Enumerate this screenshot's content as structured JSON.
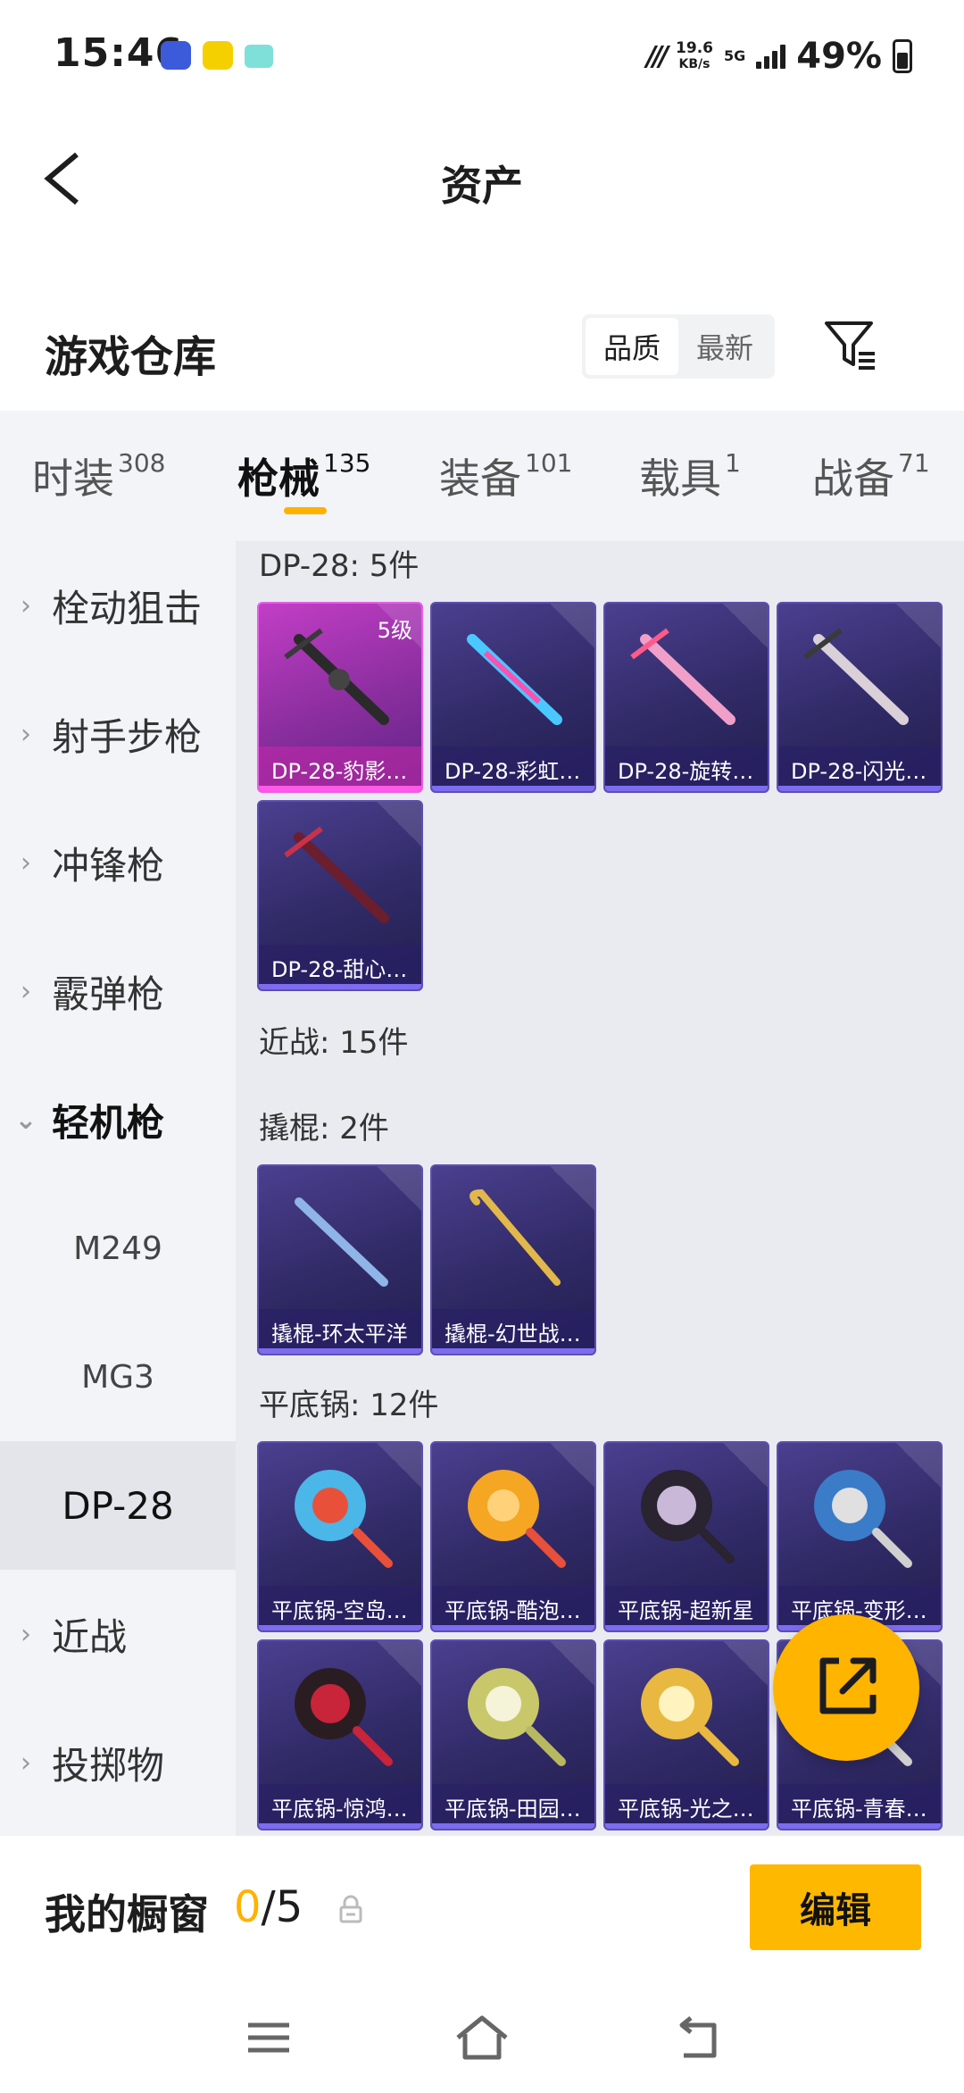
{
  "status_bar": {
    "time": "15:46",
    "network_speed": "19.6",
    "network_unit": "KB/s",
    "network_type": "5G",
    "battery": "49%"
  },
  "title_bar": {
    "title": "资产"
  },
  "warehouse": {
    "title": "游戏仓库",
    "sort_options": [
      "品质",
      "最新"
    ],
    "sort_active": "品质"
  },
  "category_tabs": [
    {
      "label": "时装",
      "count": "308"
    },
    {
      "label": "枪械",
      "count": "135",
      "active": true
    },
    {
      "label": "装备",
      "count": "101"
    },
    {
      "label": "载具",
      "count": "1"
    },
    {
      "label": "战备",
      "count": "71"
    }
  ],
  "sidebar": [
    {
      "label": "栓动狙击",
      "type": "collapsed"
    },
    {
      "label": "射手步枪",
      "type": "collapsed"
    },
    {
      "label": "冲锋枪",
      "type": "collapsed"
    },
    {
      "label": "霰弹枪",
      "type": "collapsed"
    },
    {
      "label": "轻机枪",
      "type": "expanded"
    },
    {
      "label": "M249",
      "type": "sub"
    },
    {
      "label": "MG3",
      "type": "sub"
    },
    {
      "label": "DP-28",
      "type": "selected"
    },
    {
      "label": "近战",
      "type": "collapsed"
    },
    {
      "label": "投掷物",
      "type": "collapsed"
    }
  ],
  "sections": {
    "dp28": {
      "label": "DP-28: 5件"
    },
    "melee": {
      "label": "近战: 15件"
    },
    "crowbar": {
      "label": "撬棍: 2件"
    },
    "pan": {
      "label": "平底锅: 12件"
    }
  },
  "items": {
    "dp28": [
      {
        "name": "DP-28-豹影…",
        "level": "5级",
        "rarity": "legend"
      },
      {
        "name": "DP-28-彩虹…"
      },
      {
        "name": "DP-28-旋转…"
      },
      {
        "name": "DP-28-闪光…"
      },
      {
        "name": "DP-28-甜心…"
      }
    ],
    "crowbar": [
      {
        "name": "撬棍-环太平洋"
      },
      {
        "name": "撬棍-幻世战…"
      }
    ],
    "pan": [
      {
        "name": "平底锅-空岛…"
      },
      {
        "name": "平底锅-酷泡…"
      },
      {
        "name": "平底锅-超新星"
      },
      {
        "name": "平底锅-变形…"
      },
      {
        "name": "平底锅-惊鸿…"
      },
      {
        "name": "平底锅-田园…"
      },
      {
        "name": "平底锅-光之…"
      },
      {
        "name": "平底锅-青春…"
      }
    ]
  },
  "showcase": {
    "label": "我的橱窗",
    "current": "0",
    "separator": "/",
    "max": "5",
    "edit_label": "编辑"
  },
  "colors": {
    "accent": "#ffb400",
    "card_epic": "#302a66",
    "card_legend": "#a236b4",
    "sidebar_bg": "#f3f4f8",
    "content_bg": "#e9ebf0"
  }
}
